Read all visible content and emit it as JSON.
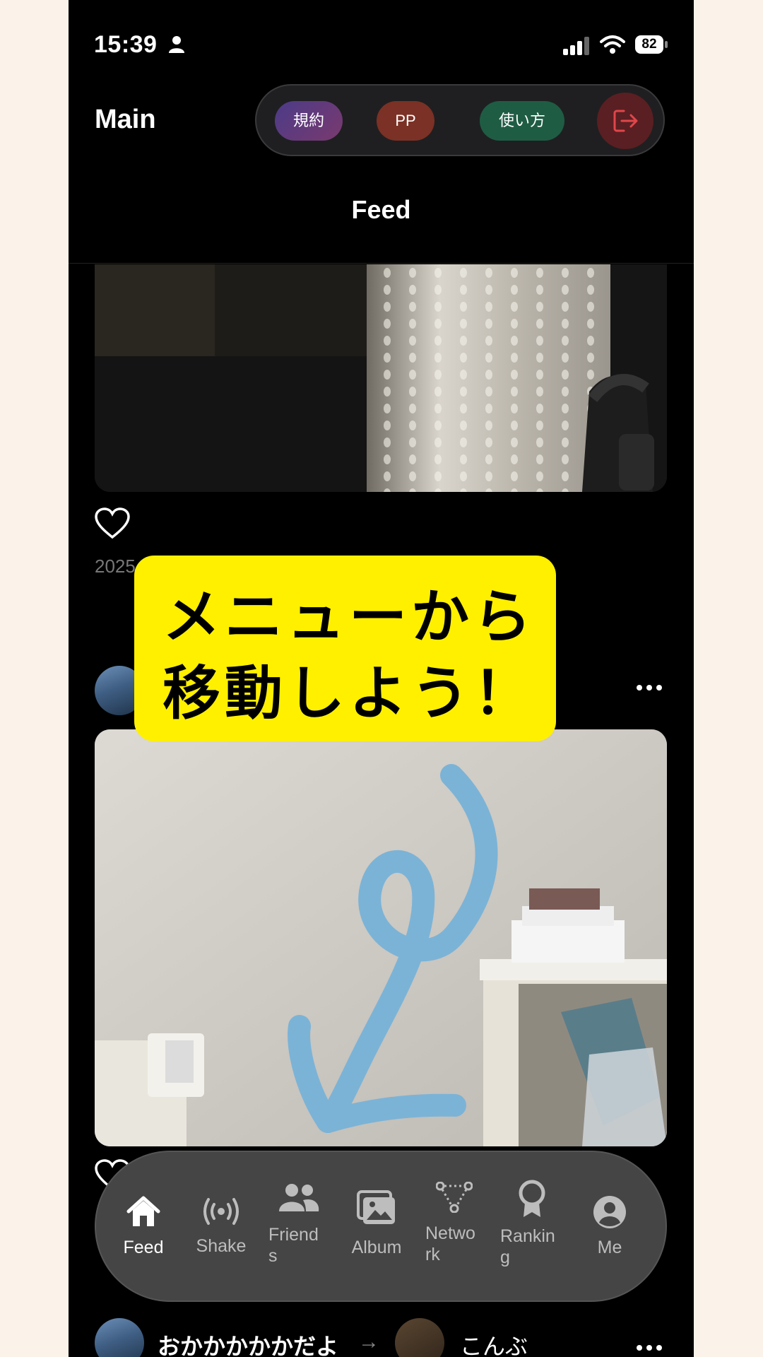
{
  "status_bar": {
    "time": "15:39",
    "battery": "82"
  },
  "header": {
    "title": "Main",
    "menu": {
      "terms": "規約",
      "pp": "PP",
      "howto": "使い方"
    },
    "feed_title": "Feed"
  },
  "posts": [
    {
      "date": "2025"
    },
    {
      "user": "おかかかかかだよ",
      "target": "こんぶ"
    }
  ],
  "tabs": [
    {
      "label": "Feed",
      "icon": "home-icon"
    },
    {
      "label": "Shake",
      "icon": "broadcast-icon"
    },
    {
      "label": "Friend\ns",
      "icon": "people-icon"
    },
    {
      "label": "Album",
      "icon": "album-icon"
    },
    {
      "label": "Netwo\nrk",
      "icon": "network-icon"
    },
    {
      "label": "Rankin\ng",
      "icon": "award-icon"
    },
    {
      "label": "Me",
      "icon": "profile-icon"
    }
  ],
  "callout": {
    "line1": "メニューから",
    "line2": "移動しよう！"
  },
  "colors": {
    "callout": "#fff000",
    "arrow": "#7bb3d6",
    "logout": "#e0464a"
  }
}
